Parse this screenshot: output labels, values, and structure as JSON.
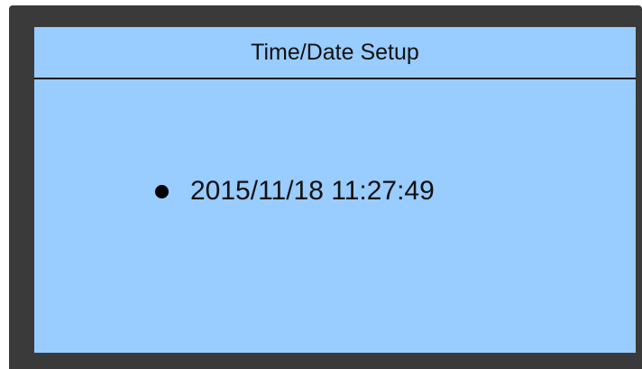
{
  "screen": {
    "title": "Time/Date Setup",
    "datetime_value": "2015/11/18 11:27:49"
  },
  "colors": {
    "frame": "#3a3a3a",
    "screen_background": "#99ccff",
    "text": "#111111"
  },
  "icons": {
    "selection_marker": "bullet-icon"
  }
}
